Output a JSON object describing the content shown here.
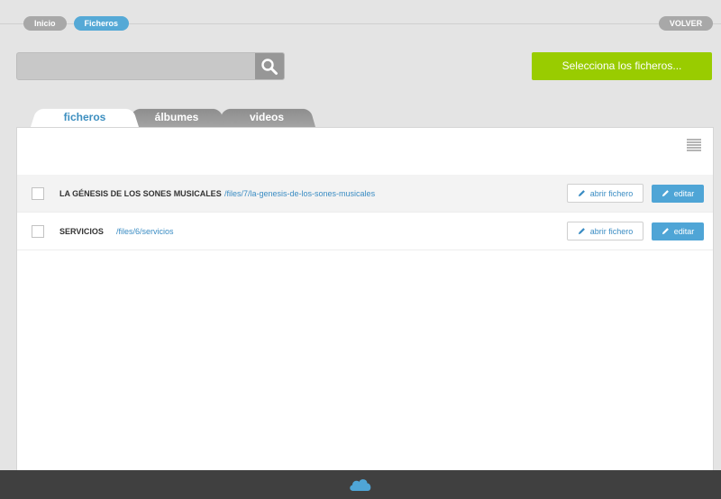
{
  "breadcrumb": {
    "home": "Inicio",
    "current": "Ficheros"
  },
  "back_label": "VOLVER",
  "search": {
    "placeholder": ""
  },
  "select_files_label": "Selecciona los ficheros...",
  "tabs": [
    {
      "label": "ficheros",
      "active": true
    },
    {
      "label": "álbumes",
      "active": false
    },
    {
      "label": "videos",
      "active": false
    }
  ],
  "files": [
    {
      "name": "LA GÉNESIS DE LOS SONES MUSICALES",
      "path": "/files/7/la-genesis-de-los-sones-musicales",
      "open_label": "abrir fichero",
      "edit_label": "editar"
    },
    {
      "name": "SERVICIOS",
      "path": "/files/6/servicios",
      "open_label": "abrir fichero",
      "edit_label": "editar"
    }
  ],
  "colors": {
    "accent": "#55a9d6",
    "primary_action": "#99cc00",
    "footer": "#404040"
  },
  "icons": {
    "search": "magnifier-icon",
    "view": "grid-view-icon",
    "open": "pencil-icon",
    "edit": "pencil-icon",
    "logo": "cloud-icon"
  }
}
